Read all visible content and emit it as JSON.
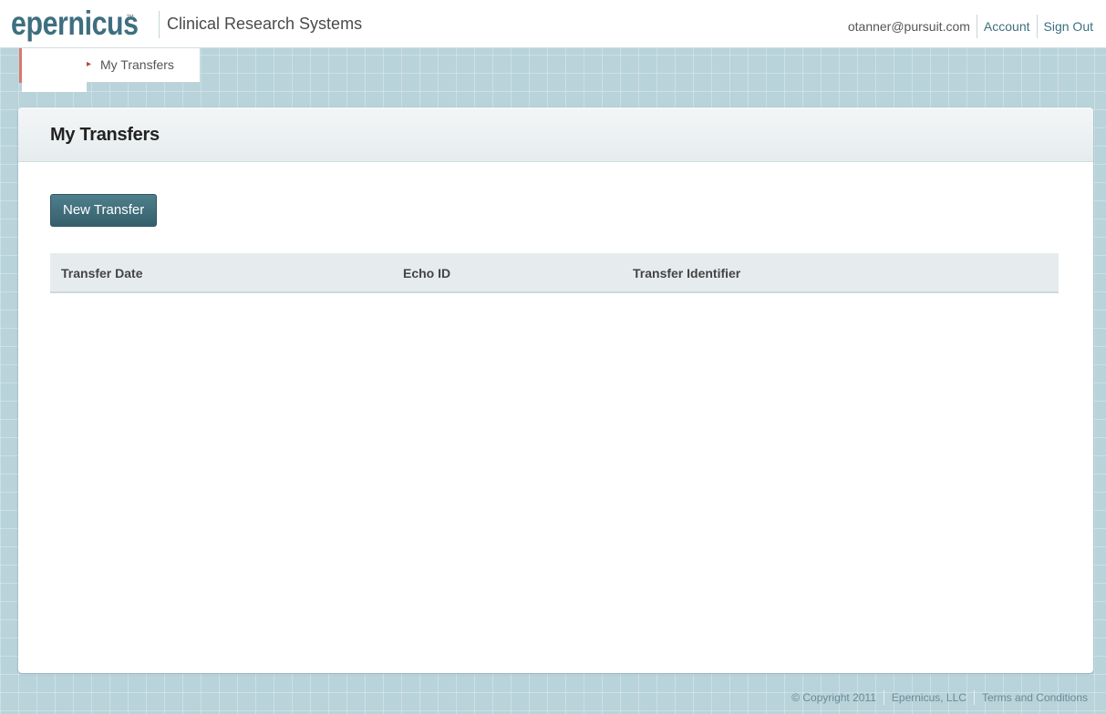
{
  "header": {
    "logo_text": "epernicus",
    "logo_mark": "™",
    "app_name": "Clinical Research Systems",
    "user_email": "otanner@pursuit.com",
    "account_label": "Account",
    "signout_label": "Sign Out"
  },
  "breadcrumb": {
    "chevron_icon": "chevron-right-icon",
    "current": "My Transfers"
  },
  "main": {
    "title": "My Transfers",
    "new_transfer_label": "New Transfer",
    "table": {
      "columns": [
        "Transfer Date",
        "Echo ID",
        "Transfer Identifier"
      ],
      "rows": []
    }
  },
  "footer": {
    "copyright": "© Copyright 2011",
    "company_link": "Epernicus, LLC",
    "terms_link": "Terms and Conditions"
  },
  "colors": {
    "brand": "#3e6f80",
    "page_background": "#b9d3db",
    "button": "#3f6e7b",
    "breadcrumb_accent": "#b34a3c"
  }
}
